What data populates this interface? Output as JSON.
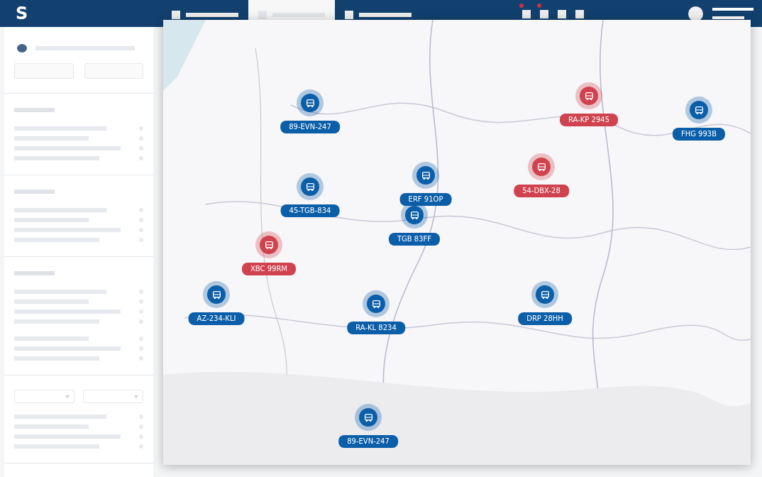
{
  "header": {
    "logo": "S",
    "tabs": [
      {
        "selected": false
      },
      {
        "selected": true
      },
      {
        "selected": false
      }
    ],
    "icons": [
      {
        "badge": true
      },
      {
        "badge": true
      },
      {
        "badge": false
      },
      {
        "badge": false
      }
    ]
  },
  "map": {
    "markers": [
      {
        "plate": "89-EVN-247",
        "color": "#0b5ea8"
      },
      {
        "plate": "RA-KP 2945",
        "color": "#d0424e"
      },
      {
        "plate": "FHG 993B",
        "color": "#0b5ea8"
      },
      {
        "plate": "45-TGB-834",
        "color": "#0b5ea8"
      },
      {
        "plate": "ERF 91OP",
        "color": "#0b5ea8"
      },
      {
        "plate": "54-DBX-28",
        "color": "#d0424e"
      },
      {
        "plate": "TGB 83FF",
        "color": "#0b5ea8"
      },
      {
        "plate": "XBC 99RM",
        "color": "#d0424e"
      },
      {
        "plate": "AZ-234-KLI",
        "color": "#0b5ea8"
      },
      {
        "plate": "RA-KL 8234",
        "color": "#0b5ea8"
      },
      {
        "plate": "DRP 28HH",
        "color": "#0b5ea8"
      },
      {
        "plate": "89-EVN-247",
        "color": "#0b5ea8"
      }
    ]
  }
}
